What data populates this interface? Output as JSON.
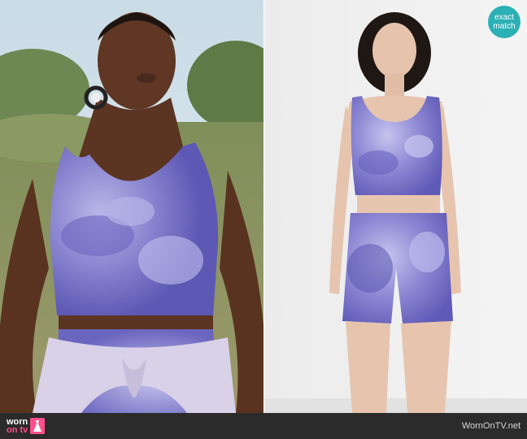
{
  "badge": {
    "line1": "exact",
    "line2": "match",
    "color": "#2bb0b6"
  },
  "footer": {
    "logo_top": "worn",
    "logo_bottom": "on tv",
    "domain": "WornOnTV.net",
    "background": "#2b2b2b",
    "accent": "#ff4f8b"
  },
  "photos": {
    "left": "photo of a woman outdoors wearing a tie-dye crop top with a sweatshirt tied at the waist",
    "right": "studio photo of a model wearing a matching tie-dye crop top and bike shorts set"
  },
  "colors": {
    "tie_dye_purple": "#7d78c8",
    "tie_dye_light": "#b8b8e6",
    "tie_dye_dark": "#5a55b0"
  }
}
